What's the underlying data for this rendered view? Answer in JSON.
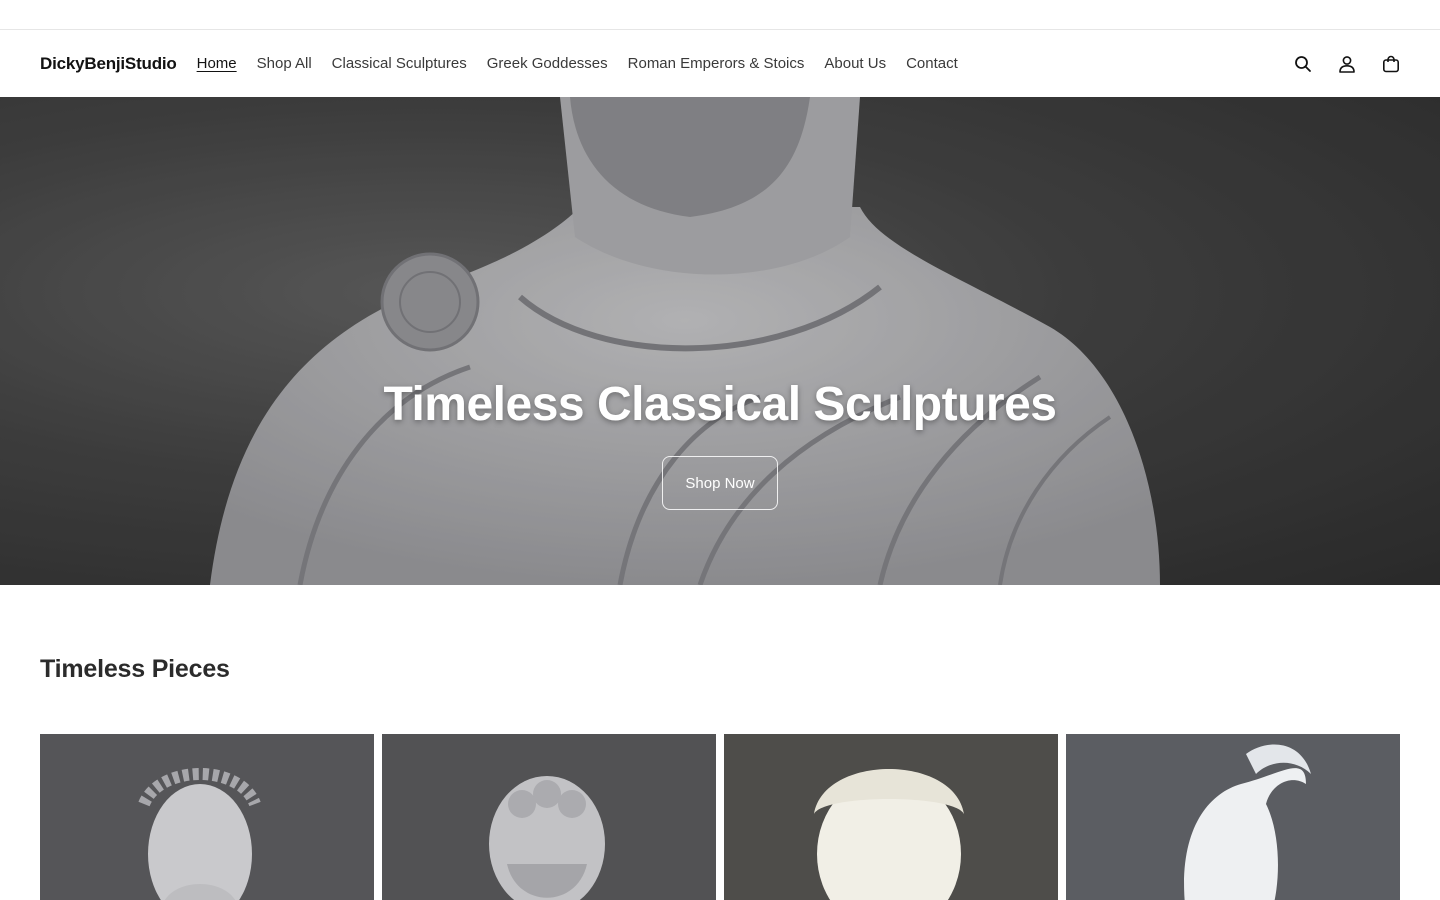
{
  "header": {
    "logo": "DickyBenjiStudio",
    "nav": [
      {
        "label": "Home",
        "active": true
      },
      {
        "label": "Shop All"
      },
      {
        "label": "Classical Sculptures"
      },
      {
        "label": "Greek Goddesses"
      },
      {
        "label": "Roman Emperors & Stoics"
      },
      {
        "label": "About Us"
      },
      {
        "label": "Contact"
      }
    ],
    "icons": [
      "search-icon",
      "account-icon",
      "cart-icon"
    ]
  },
  "hero": {
    "title": "Timeless Classical Sculptures",
    "button_label": "Shop Now"
  },
  "collection": {
    "title": "Timeless Pieces",
    "products": [
      {
        "image": "laurel-wreath-bust"
      },
      {
        "image": "bearded-philosopher-bust"
      },
      {
        "image": "curly-hair-ivory-bust"
      },
      {
        "image": "crested-helmet-bust"
      }
    ]
  },
  "colors": {
    "text": "#121212",
    "nav_text": "#3a3a3a",
    "hero_text": "#ffffff",
    "marble": "#d9d9db"
  }
}
